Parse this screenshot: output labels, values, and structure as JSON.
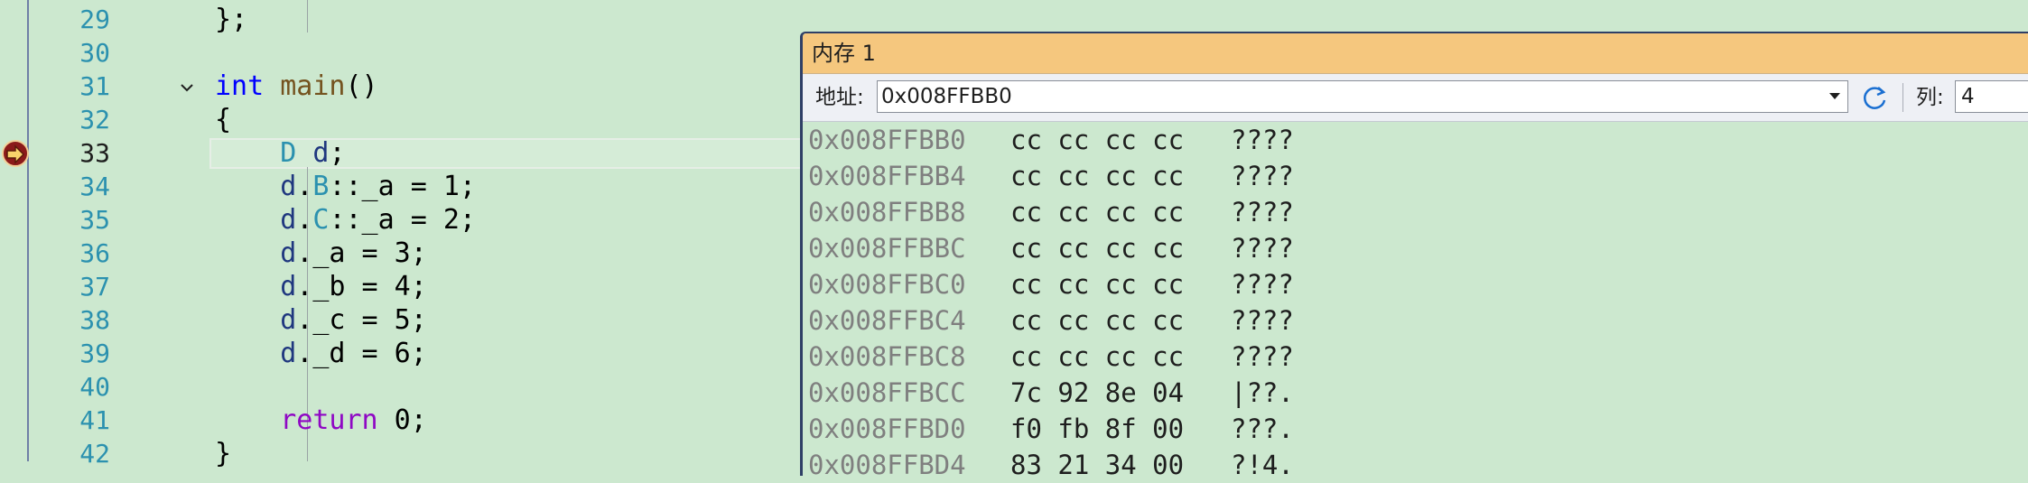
{
  "editor": {
    "lines": [
      {
        "num": "29",
        "tokens": [
          {
            "t": "};",
            "c": ""
          }
        ]
      },
      {
        "num": "30",
        "tokens": []
      },
      {
        "num": "31",
        "tokens": [
          {
            "t": "int",
            "c": "kw"
          },
          {
            "t": " ",
            "c": ""
          },
          {
            "t": "main",
            "c": "fn"
          },
          {
            "t": "()",
            "c": ""
          }
        ]
      },
      {
        "num": "32",
        "tokens": [
          {
            "t": "{",
            "c": ""
          }
        ]
      },
      {
        "num": "33",
        "tokens": [
          {
            "t": "    ",
            "c": ""
          },
          {
            "t": "D",
            "c": "ty"
          },
          {
            "t": " ",
            "c": ""
          },
          {
            "t": "d",
            "c": "var"
          },
          {
            "t": ";",
            "c": ""
          }
        ]
      },
      {
        "num": "34",
        "tokens": [
          {
            "t": "    ",
            "c": ""
          },
          {
            "t": "d",
            "c": "var"
          },
          {
            "t": ".",
            "c": ""
          },
          {
            "t": "B",
            "c": "ty"
          },
          {
            "t": "::_a = 1;",
            "c": ""
          }
        ]
      },
      {
        "num": "35",
        "tokens": [
          {
            "t": "    ",
            "c": ""
          },
          {
            "t": "d",
            "c": "var"
          },
          {
            "t": ".",
            "c": ""
          },
          {
            "t": "C",
            "c": "ty"
          },
          {
            "t": "::_a = 2;",
            "c": ""
          }
        ]
      },
      {
        "num": "36",
        "tokens": [
          {
            "t": "    ",
            "c": ""
          },
          {
            "t": "d",
            "c": "var"
          },
          {
            "t": "._a = 3;",
            "c": ""
          }
        ]
      },
      {
        "num": "37",
        "tokens": [
          {
            "t": "    ",
            "c": ""
          },
          {
            "t": "d",
            "c": "var"
          },
          {
            "t": "._b = 4;",
            "c": ""
          }
        ]
      },
      {
        "num": "38",
        "tokens": [
          {
            "t": "    ",
            "c": ""
          },
          {
            "t": "d",
            "c": "var"
          },
          {
            "t": "._c = 5;",
            "c": ""
          }
        ]
      },
      {
        "num": "39",
        "tokens": [
          {
            "t": "    ",
            "c": ""
          },
          {
            "t": "d",
            "c": "var"
          },
          {
            "t": "._d = 6;",
            "c": ""
          }
        ]
      },
      {
        "num": "40",
        "tokens": []
      },
      {
        "num": "41",
        "tokens": [
          {
            "t": "    ",
            "c": ""
          },
          {
            "t": "return",
            "c": "kw2"
          },
          {
            "t": " 0;",
            "c": ""
          }
        ]
      },
      {
        "num": "42",
        "tokens": [
          {
            "t": "}",
            "c": ""
          }
        ]
      }
    ],
    "current_line": "33"
  },
  "memory_window": {
    "title": "内存 1",
    "address_label": "地址:",
    "address_value": "0x008FFBB0",
    "columns_label": "列:",
    "columns_value": "4",
    "rows": [
      {
        "addr": "0x008FFBB0",
        "bytes": "cc cc cc cc",
        "ascii": "????"
      },
      {
        "addr": "0x008FFBB4",
        "bytes": "cc cc cc cc",
        "ascii": "????"
      },
      {
        "addr": "0x008FFBB8",
        "bytes": "cc cc cc cc",
        "ascii": "????"
      },
      {
        "addr": "0x008FFBBC",
        "bytes": "cc cc cc cc",
        "ascii": "????"
      },
      {
        "addr": "0x008FFBC0",
        "bytes": "cc cc cc cc",
        "ascii": "????"
      },
      {
        "addr": "0x008FFBC4",
        "bytes": "cc cc cc cc",
        "ascii": "????"
      },
      {
        "addr": "0x008FFBC8",
        "bytes": "cc cc cc cc",
        "ascii": "????"
      },
      {
        "addr": "0x008FFBCC",
        "bytes": "7c 92 8e 04",
        "ascii": "|??."
      },
      {
        "addr": "0x008FFBD0",
        "bytes": "f0 fb 8f 00",
        "ascii": "???."
      },
      {
        "addr": "0x008FFBD4",
        "bytes": "83 21 34 00",
        "ascii": "?!4."
      }
    ]
  },
  "colors": {
    "background": "#cce8cf",
    "title_bar": "#f5c77e",
    "keyword": "#0000ff",
    "return_keyword": "#8f08c4",
    "function": "#74531f",
    "type": "#2b91af",
    "variable": "#1f377f"
  },
  "icons": {
    "breakpoint": "current-statement-arrow-icon",
    "fold": "collapse-chevron-icon",
    "refresh": "refresh-icon",
    "dropdown": "dropdown-arrow-icon"
  }
}
